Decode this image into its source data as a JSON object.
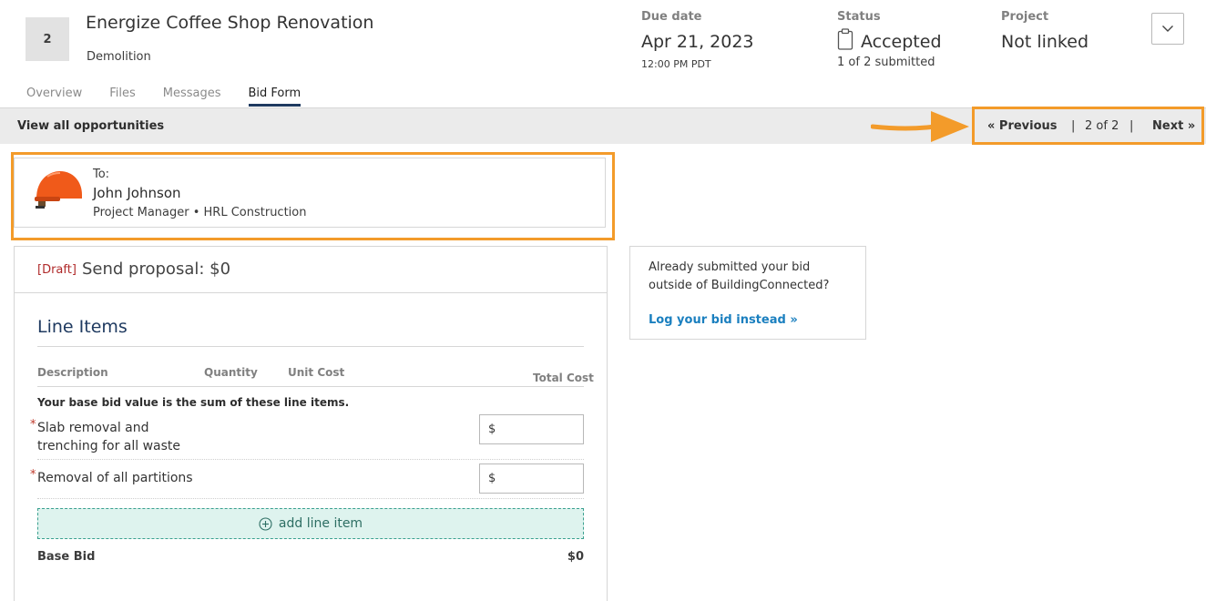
{
  "header": {
    "badge": "2",
    "title": "Energize Coffee Shop Renovation",
    "subtitle": "Demolition"
  },
  "tabs": [
    {
      "label": "Overview",
      "active": false
    },
    {
      "label": "Files",
      "active": false
    },
    {
      "label": "Messages",
      "active": false
    },
    {
      "label": "Bid Form",
      "active": true
    }
  ],
  "meta": {
    "due": {
      "label": "Due date",
      "value": "Apr 21, 2023",
      "time": "12:00 PM PDT"
    },
    "status": {
      "label": "Status",
      "value": "Accepted",
      "detail": "1 of 2 submitted",
      "icon": "clipboard-icon"
    },
    "project": {
      "label": "Project",
      "value": "Not linked"
    }
  },
  "opportunities": {
    "link": "View all opportunities",
    "prev": "« Previous",
    "sep": "|",
    "count": "2 of 2",
    "next": "Next »"
  },
  "recipient": {
    "to_label": "To:",
    "name": "John Johnson",
    "role": "Project Manager • HRL Construction"
  },
  "proposal": {
    "draft_tag": "[Draft]",
    "title": "Send proposal: $0"
  },
  "line_items": {
    "title": "Line Items",
    "columns": {
      "description": "Description",
      "quantity": "Quantity",
      "unit_cost": "Unit Cost",
      "total_cost": "Total Cost"
    },
    "note": "Your base bid value is the sum of these line items.",
    "items": [
      {
        "label_line1": "Slab removal and",
        "label_line2": "trenching for all waste",
        "required": "*",
        "value": "$"
      },
      {
        "label_line1": "Removal of all partitions",
        "label_line2": "",
        "required": "*",
        "value": "$"
      }
    ],
    "add_label": "add line item",
    "base_bid_label": "Base Bid",
    "base_bid_value": "$0"
  },
  "side": {
    "text": "Already submitted your bid outside of BuildingConnected?",
    "link": "Log your bid instead »"
  },
  "colors": {
    "highlight": "#f39b2a",
    "link_blue": "#1a7fbf",
    "draft_red": "#b02a2a",
    "add_bg": "#def3ee",
    "nav_underline": "#1f3a60"
  }
}
